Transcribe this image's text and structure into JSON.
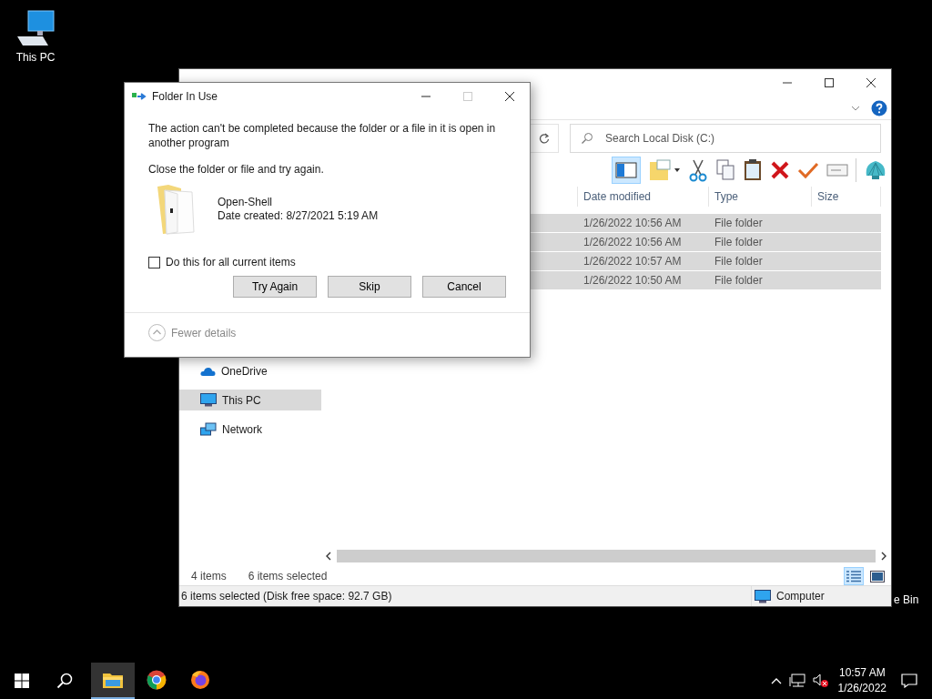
{
  "desktop_icons": [
    {
      "label": "This PC"
    },
    {
      "label": "e Bin"
    }
  ],
  "explorer": {
    "search": {
      "placeholder": "Search Local Disk (C:)"
    },
    "columns": [
      "Date modified",
      "Type",
      "Size"
    ],
    "rows": [
      {
        "date_modified": "1/26/2022 10:56 AM",
        "type": "File folder",
        "selected": true
      },
      {
        "date_modified": "1/26/2022 10:56 AM",
        "type": "File folder",
        "selected": true
      },
      {
        "date_modified": "1/26/2022 10:57 AM",
        "type": "File folder",
        "selected": true
      },
      {
        "date_modified": "1/26/2022 10:50 AM",
        "type": "File folder",
        "selected": true
      }
    ],
    "nav_items": [
      {
        "label": "OneDrive",
        "kind": "cloud",
        "selected": false
      },
      {
        "label": "This PC",
        "kind": "pc",
        "selected": true
      },
      {
        "label": "Network",
        "kind": "network",
        "selected": false
      }
    ],
    "item_count": "4 items",
    "selection_count": "6 items selected",
    "status_bar": {
      "text": "6 items selected (Disk free space: 92.7 GB)",
      "location": "Computer"
    }
  },
  "dialog": {
    "title": "Folder In Use",
    "message": "The action can't be completed because the folder or a file in it is open in another program",
    "instruction": "Close the folder or file and try again.",
    "file": {
      "name": "Open-Shell",
      "date_created": "Date created: 8/27/2021 5:19 AM"
    },
    "checkbox": {
      "label": "Do this for all current items",
      "checked": false
    },
    "buttons": [
      "Try Again",
      "Skip",
      "Cancel"
    ],
    "details_toggle": "Fewer details"
  },
  "taskbar": {
    "apps": [
      {
        "kind": "explorer",
        "active": true
      },
      {
        "kind": "chrome",
        "active": false
      },
      {
        "kind": "firefox",
        "active": false
      }
    ],
    "time": "10:57 AM",
    "date": "1/26/2022"
  }
}
